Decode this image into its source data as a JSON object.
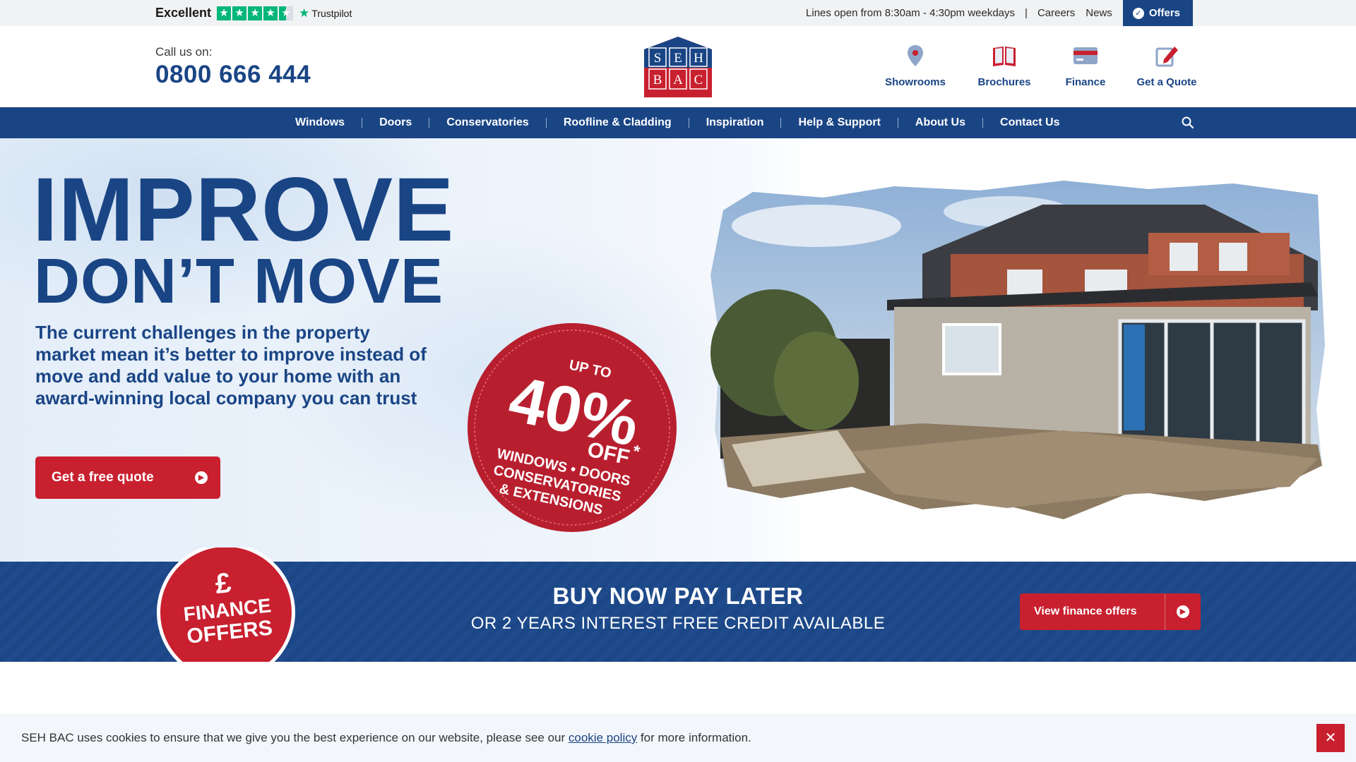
{
  "topbar": {
    "trustpilot_label": "Excellent",
    "trustpilot_brand": "Trustpilot",
    "rating_stars": 4.5,
    "hours": "Lines open from 8:30am - 4:30pm weekdays",
    "separator": "|",
    "careers": "Careers",
    "news": "News",
    "offers": "Offers"
  },
  "header": {
    "call_label": "Call us on:",
    "phone": "0800 666 444",
    "logo_letters_top": [
      "S",
      "E",
      "H"
    ],
    "logo_letters_bottom": [
      "B",
      "A",
      "C"
    ],
    "icons": [
      {
        "label": "Showrooms",
        "icon": "map-pin-icon"
      },
      {
        "label": "Brochures",
        "icon": "book-icon"
      },
      {
        "label": "Finance",
        "icon": "card-icon"
      },
      {
        "label": "Get a Quote",
        "icon": "edit-icon"
      }
    ]
  },
  "nav": {
    "items": [
      "Windows",
      "Doors",
      "Conservatories",
      "Roofline & Cladding",
      "Inspiration",
      "Help & Support",
      "About Us",
      "Contact Us"
    ],
    "search_icon": "search-icon"
  },
  "hero": {
    "title_line1": "IMPROVE",
    "title_line2": "DON’T MOVE",
    "subtitle": "The current challenges in the property market mean it’s better to improve instead of move and add value to your home with an award-winning local company you can trust",
    "cta": "Get a free quote",
    "badge": {
      "up_to": "UP TO",
      "percent": "40%",
      "off": "OFF",
      "asterisk": "*",
      "line1": "WINDOWS • DOORS",
      "line2": "CONSERVATORIES",
      "line3": "& EXTENSIONS"
    }
  },
  "finance": {
    "badge_symbol": "£",
    "badge_line1": "FINANCE",
    "badge_line2": "OFFERS",
    "heading": "BUY NOW PAY LATER",
    "subheading": "OR 2 YEARS INTEREST FREE CREDIT AVAILABLE",
    "button": "View finance offers"
  },
  "cookie": {
    "text_before": "SEH BAC uses cookies to ensure that we give you the best experience on our website, please see our ",
    "link": "cookie policy",
    "text_after": " for more information.",
    "close": "✕"
  },
  "colors": {
    "brand_blue": "#1a4585",
    "brand_red": "#c8202f",
    "trustpilot_green": "#00b67a"
  }
}
